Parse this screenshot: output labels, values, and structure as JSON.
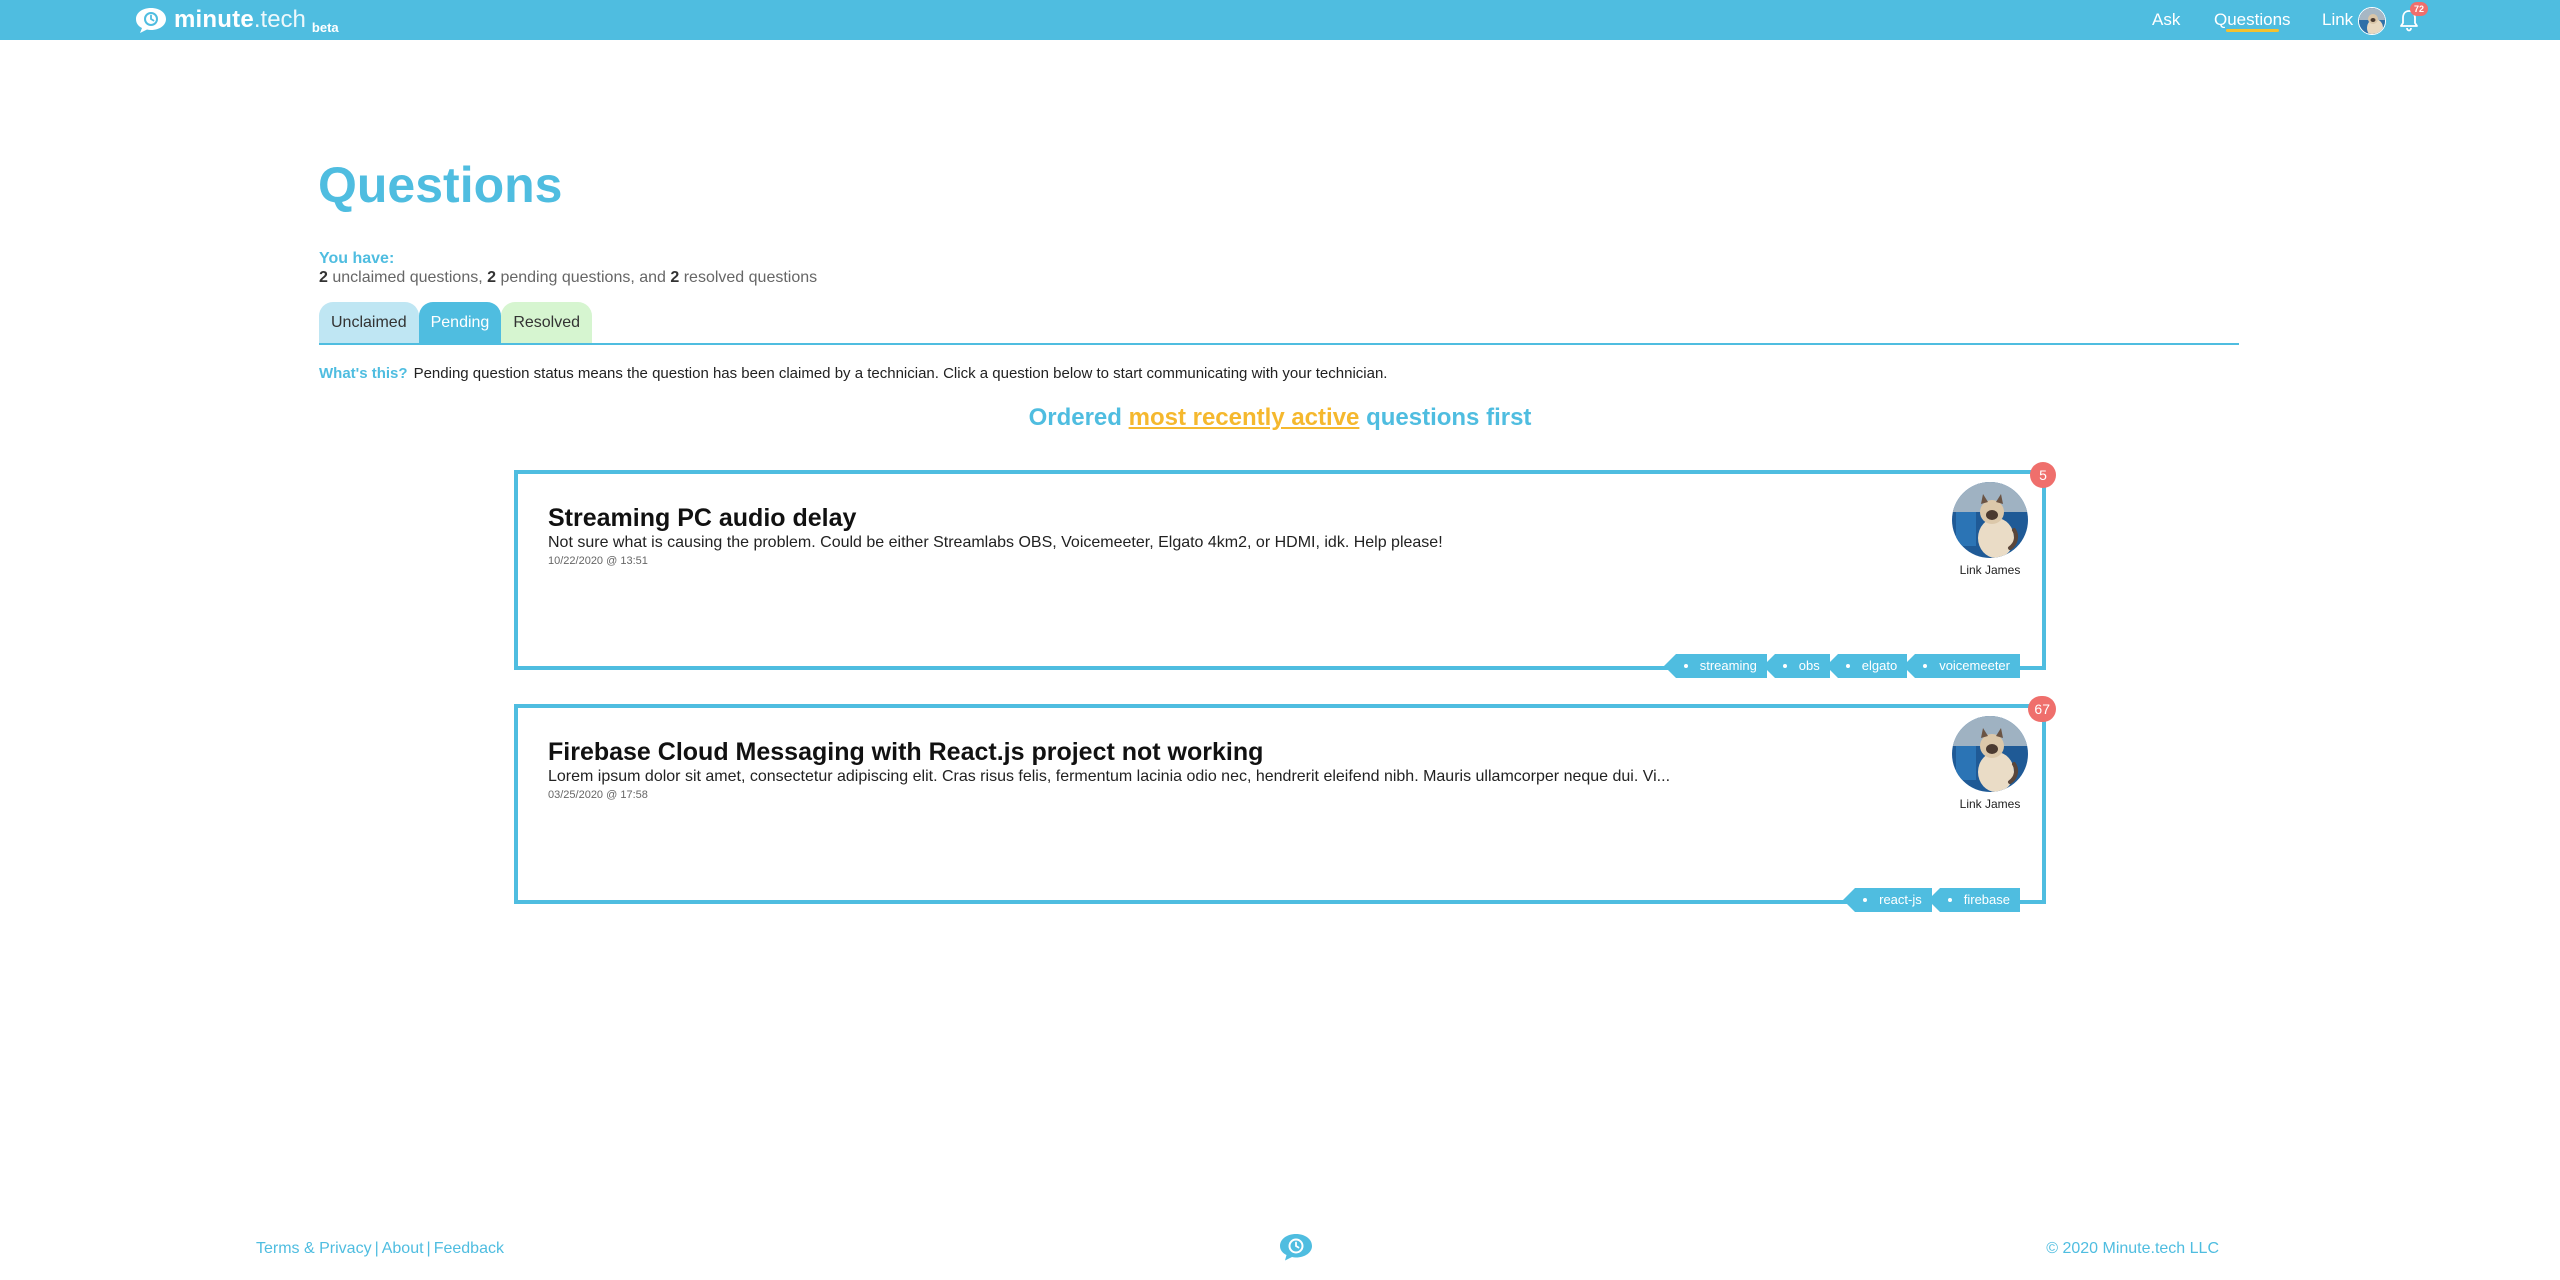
{
  "brand": {
    "name": "minute",
    "tld": ".tech",
    "beta": "beta"
  },
  "nav": {
    "ask": "Ask",
    "questions": "Questions",
    "user": "Link",
    "notification_count": "72"
  },
  "page": {
    "title": "Questions",
    "you_have_label": "You have:",
    "counts": {
      "unclaimed": "2",
      "unclaimed_text": " unclaimed questions, ",
      "pending": "2",
      "pending_text": " pending questions, and ",
      "resolved": "2",
      "resolved_text": " resolved questions"
    }
  },
  "tabs": [
    {
      "label": "Unclaimed"
    },
    {
      "label": "Pending",
      "active": true
    },
    {
      "label": "Resolved"
    }
  ],
  "whats_this": {
    "label": "What's this?",
    "text": "Pending question status means the question has been claimed by a technician. Click a question below to start communicating with your technician."
  },
  "ordering": {
    "prefix": "Ordered",
    "highlight": "most recently active",
    "suffix": "questions first"
  },
  "questions": [
    {
      "title": "Streaming PC audio delay",
      "description": "Not sure what is causing the problem. Could be either Streamlabs OBS, Voicemeeter, Elgato 4km2, or HDMI, idk. Help please!",
      "date": "10/22/2020 @ 13:51",
      "technician": "Link James",
      "messages": "5",
      "tags": [
        "streaming",
        "obs",
        "elgato",
        "voicemeeter"
      ]
    },
    {
      "title": "Firebase Cloud Messaging with React.js project not working",
      "description": "Lorem ipsum dolor sit amet, consectetur adipiscing elit. Cras risus felis, fermentum lacinia odio nec, hendrerit eleifend nibh. Mauris ullamcorper neque dui. Vi...",
      "date": "03/25/2020 @ 17:58",
      "technician": "Link James",
      "messages": "67",
      "tags": [
        "react-js",
        "firebase"
      ]
    }
  ],
  "footer": {
    "terms": "Terms & Privacy",
    "about": "About",
    "feedback": "Feedback",
    "separator": "|",
    "copyright": "© 2020 Minute.tech LLC"
  },
  "colors": {
    "primary": "#4fbde0",
    "accent": "#f5b82e",
    "badge": "#ef6f6c",
    "tab_unclaimed": "#bfe6f3",
    "tab_resolved": "#d6f5d0"
  }
}
